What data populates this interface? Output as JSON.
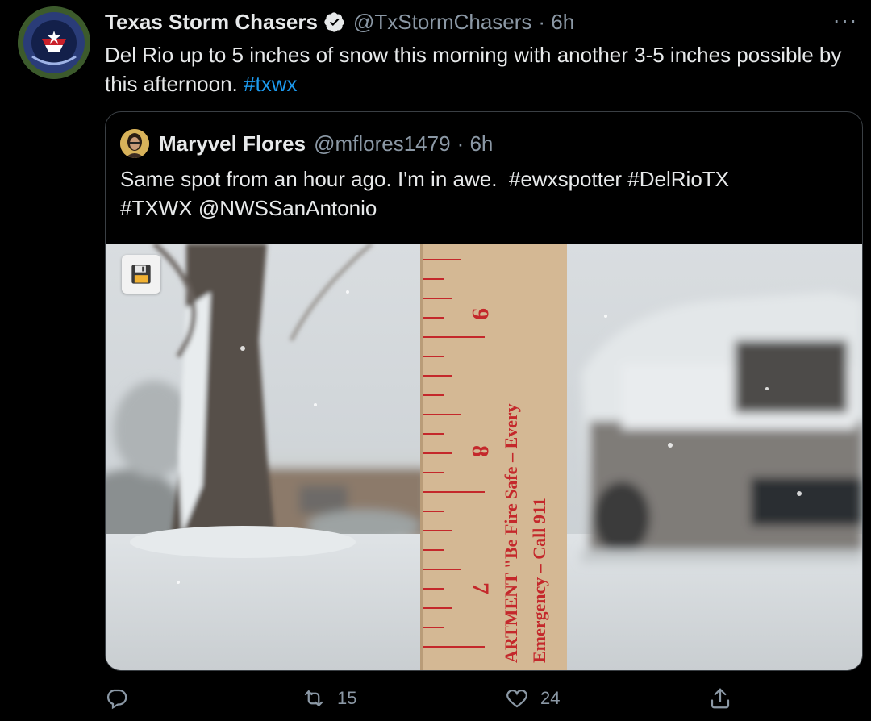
{
  "tweet": {
    "author_name": "Texas Storm Chasers",
    "author_handle": "@TxStormChasers",
    "time": "· 6h",
    "text_main": "Del Rio up to 5 inches of snow this morning with another 3-5 inches possible by this afternoon.",
    "hashtag": "#txwx",
    "more_label": "···"
  },
  "quote": {
    "author_name": "Maryvel Flores",
    "author_handle": "@mflores1479",
    "time": "· 6h",
    "text": "Same spot from an hour ago.  I'm in awe.",
    "hashtags_line1": [
      "#ewxspotter",
      "#DelRioTX"
    ],
    "hashtags_line2": [
      "#TXWX",
      "@NWSSanAntonio"
    ],
    "photo": {
      "ruler_texts": {
        "num_9": "9",
        "num_8": "8",
        "num_7": "7",
        "line_left": "ARTMENT  \"Be  Fire  Safe  –  Every",
        "line_right": "Emergency  –  Call  911"
      }
    }
  },
  "actions": {
    "reply_count": "",
    "retweet_count": "15",
    "like_count": "24"
  },
  "icons": {
    "verified": "verified-badge-icon",
    "reply": "reply-icon",
    "retweet": "retweet-icon",
    "like": "heart-icon",
    "share": "share-icon",
    "save": "floppy-disk-icon",
    "more": "more-options-icon"
  },
  "colors": {
    "background": "#000000",
    "link": "#1d9bf0",
    "secondary_text": "#8b98a5",
    "border": "#3a3f44",
    "ruler_red": "#c4282b"
  }
}
